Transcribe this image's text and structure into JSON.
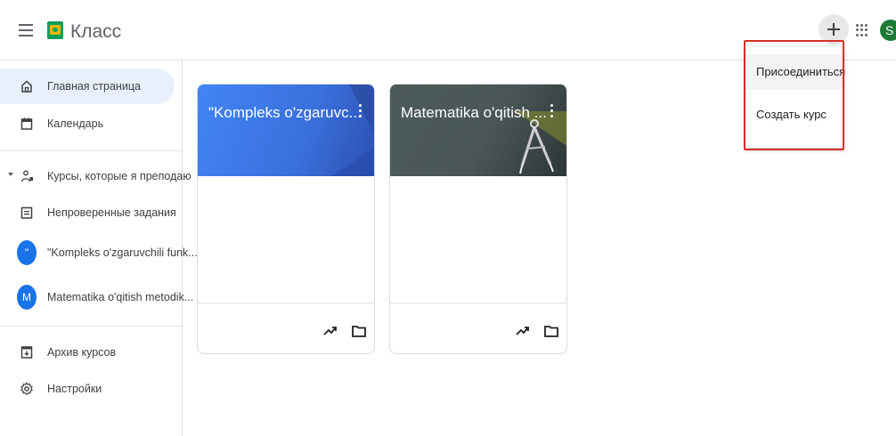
{
  "app": {
    "title": "Класс",
    "avatar_letter": "S",
    "accent_color": "#1a73e8",
    "brand_color": "#0f9d58"
  },
  "header": {
    "menu_icon": "hamburger-icon",
    "add_icon": "plus-icon",
    "apps_icon": "apps-grid-icon"
  },
  "dropdown": {
    "items": [
      {
        "label": "Присоединиться"
      },
      {
        "label": "Создать курс"
      }
    ],
    "highlight_color": "#d93025"
  },
  "sidebar": {
    "items": [
      {
        "label": "Главная страница",
        "icon": "home-icon"
      },
      {
        "label": "Календарь",
        "icon": "calendar-icon"
      },
      {
        "label": "Курсы, которые я преподаю",
        "icon": "teaching-people-icon"
      },
      {
        "label": "Непроверенные задания",
        "icon": "assignment-icon"
      },
      {
        "label": "\"Kompleks o'zgaruvchili funk...",
        "icon": "course-avatar",
        "avatar": "\""
      },
      {
        "label": "Matematika o'qitish metodik...",
        "icon": "course-avatar",
        "avatar": "M"
      },
      {
        "label": "Архив курсов",
        "icon": "archive-icon"
      },
      {
        "label": "Настройки",
        "icon": "gear-icon"
      }
    ]
  },
  "cards": [
    {
      "title": "\"Kompleks o'zgaruvc...",
      "theme_color": "#4285f4"
    },
    {
      "title": "Matematika o'qitish ...",
      "theme_color": "#4e5b5b"
    }
  ]
}
